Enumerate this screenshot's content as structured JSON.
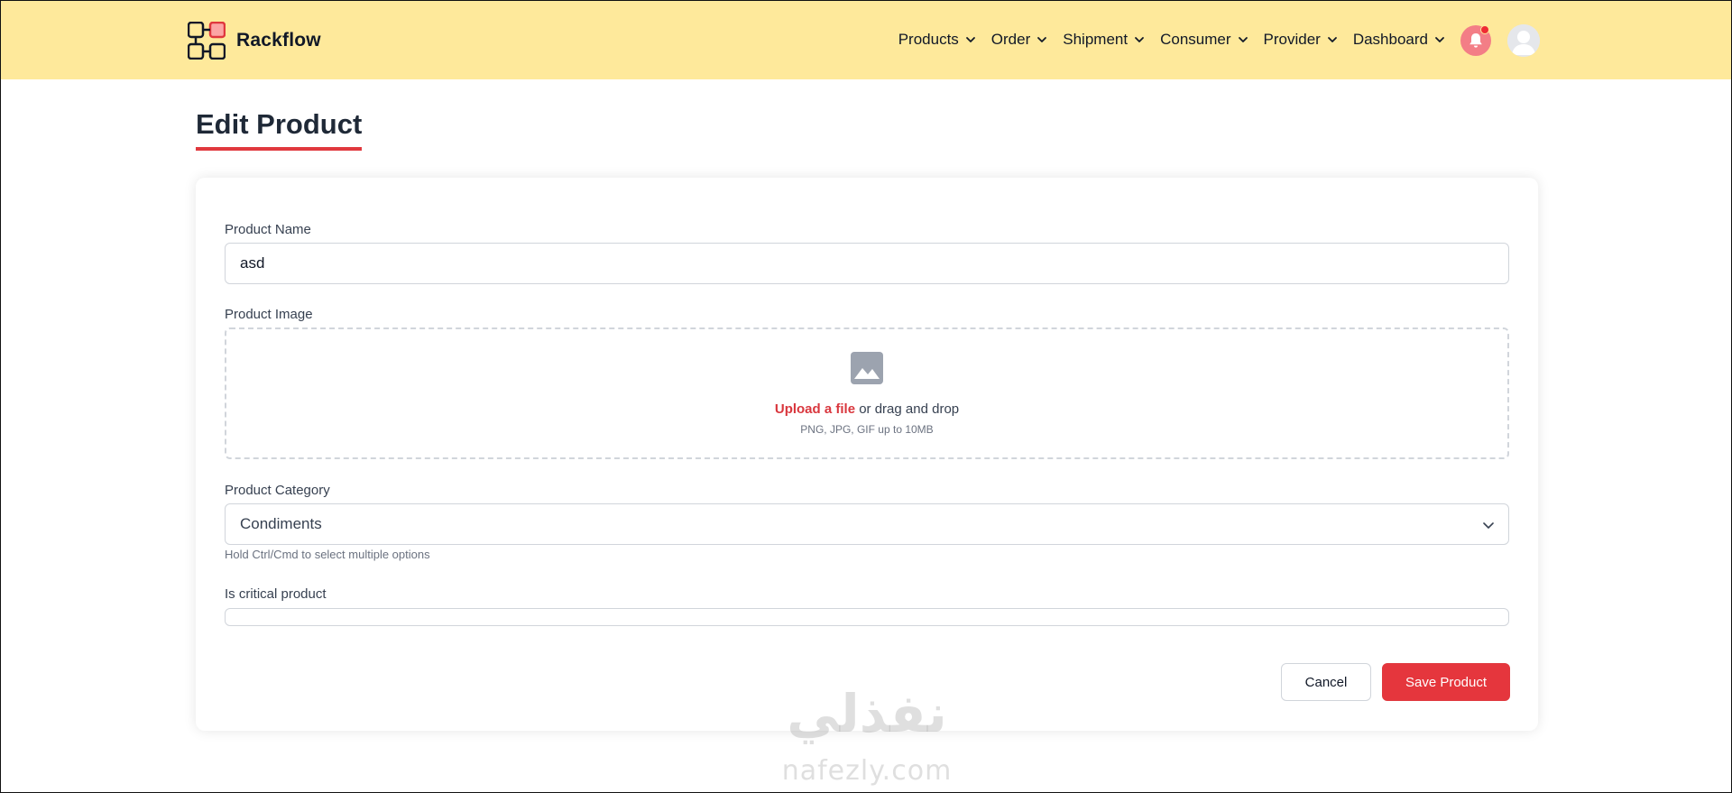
{
  "header": {
    "brand": "Rackflow",
    "nav": [
      {
        "label": "Products"
      },
      {
        "label": "Order"
      },
      {
        "label": "Shipment"
      },
      {
        "label": "Consumer"
      },
      {
        "label": "Provider"
      },
      {
        "label": "Dashboard"
      }
    ]
  },
  "page": {
    "title": "Edit Product"
  },
  "form": {
    "name_label": "Product Name",
    "name_value": "asd",
    "image_label": "Product Image",
    "upload_link": "Upload a file",
    "upload_rest": " or drag and drop",
    "upload_hint": "PNG, JPG, GIF up to 10MB",
    "category_label": "Product Category",
    "category_value": "Condiments",
    "category_hint": "Hold Ctrl/Cmd to select multiple options",
    "critical_label": "Is critical product",
    "cancel_label": "Cancel",
    "save_label": "Save Product"
  },
  "watermark": {
    "arabic": "نفذلي",
    "latin": "nafezly.com"
  },
  "colors": {
    "header_bg": "#fee99b",
    "accent": "#e5363d",
    "notification": "#f37e86"
  },
  "icons": {
    "logo": "rackflow-logo-icon",
    "nav_chevron": "chevron-down-icon",
    "notification": "bell-icon",
    "avatar": "user-avatar-icon",
    "upload": "image-icon",
    "select": "chevron-down-icon"
  }
}
